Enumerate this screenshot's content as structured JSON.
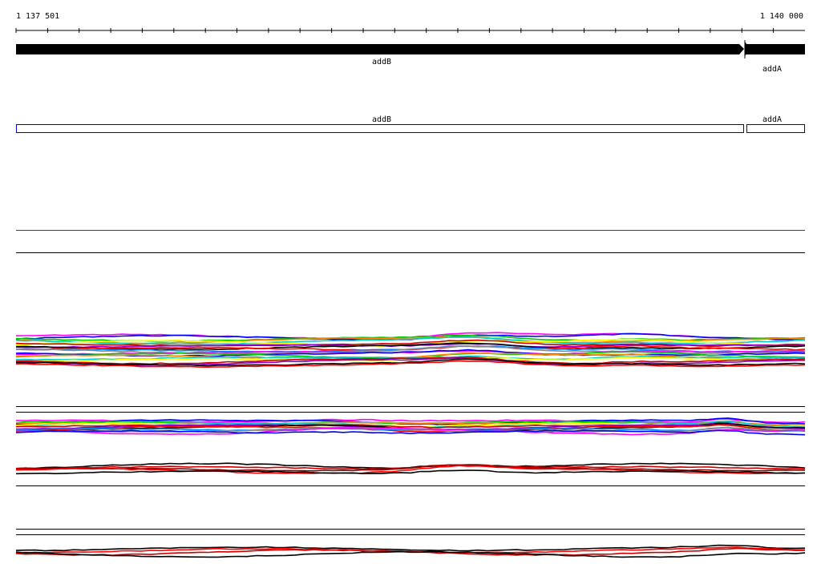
{
  "ruler": {
    "start_label": "1 137 501",
    "end_label": "1 140 000"
  },
  "genes_track": {
    "genes": [
      {
        "name": "addB",
        "strand": "+"
      },
      {
        "name": "addA",
        "strand": "+"
      }
    ]
  },
  "cds_track": {
    "genes": [
      {
        "name": "addB"
      },
      {
        "name": "addA"
      }
    ]
  },
  "colors": {
    "gene_arrow": "#000000",
    "cds_outline": "#0000cc",
    "threshold_line": "#dd0000",
    "separator": "#000000",
    "profile_palette": [
      "#ff00ff",
      "#0000ff",
      "#00cc00",
      "#ff8800",
      "#00cccc",
      "#ffff00",
      "#cc0000",
      "#8800cc",
      "#000000",
      "#ff0000",
      "#0088ff",
      "#888888"
    ]
  }
}
